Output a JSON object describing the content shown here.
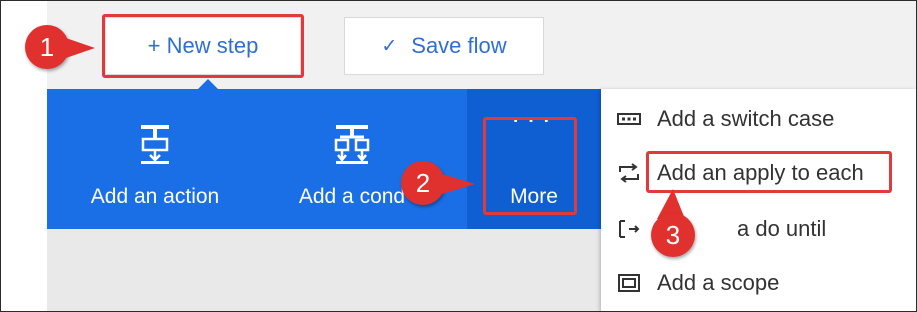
{
  "toolbar": {
    "new_step_label": "+ New step",
    "save_flow_label": "Save flow",
    "save_icon": "check-icon"
  },
  "action_bar": {
    "add_action_label": "Add an action",
    "add_condition_label": "Add a cond",
    "more_label": "More",
    "more_icon": "ellipsis-icon"
  },
  "menu": {
    "items": [
      {
        "label": "Add a switch case",
        "icon": "switch-icon"
      },
      {
        "label": "Add an apply to each",
        "icon": "loop-icon"
      },
      {
        "label": "a do until",
        "icon": "do-until-icon"
      },
      {
        "label": "Add a scope",
        "icon": "scope-icon"
      }
    ]
  },
  "callouts": {
    "step1": "1",
    "step2": "2",
    "step3": "3"
  },
  "colors": {
    "accent_blue": "#1a6fe6",
    "more_blue": "#0f5fd2",
    "link_blue": "#2f6ed4",
    "highlight_red": "#e23a3a"
  }
}
